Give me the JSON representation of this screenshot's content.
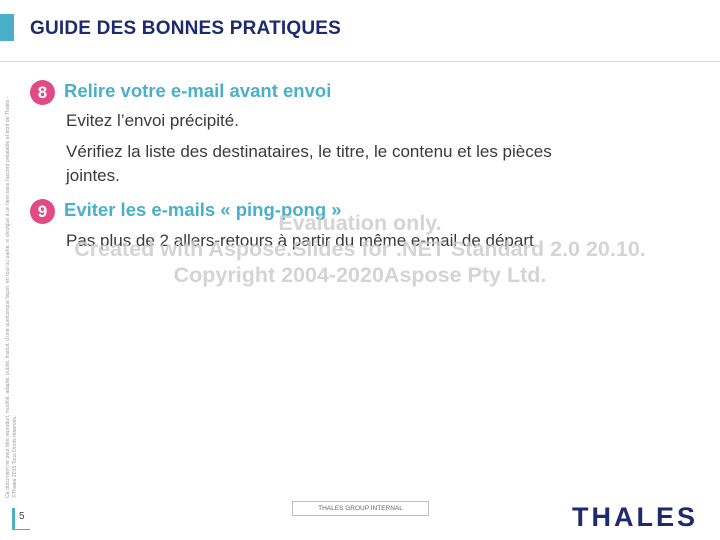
{
  "header": {
    "title": "GUIDE DES BONNES PRATIQUES"
  },
  "side_note": "Ce document ne peut être reproduit, modifié, adapté, publié, traduit, d'une quelconque façon, en tout ou partie, ni divulgué à un tiers sans l'accord préalable et écrit de Thales - ©Thales 2015 Tous Droits réservés.",
  "sections": [
    {
      "number": "8",
      "heading": "Relire votre e-mail avant envoi",
      "lines": [
        "Evitez l’envoi précipité.",
        "Vérifiez la liste des destinataires, le titre, le contenu et les pièces",
        "jointes."
      ]
    },
    {
      "number": "9",
      "heading": "Eviter les e-mails « ping-pong »",
      "lines": [
        "Pas plus de 2 allers-retours à partir du même e-mail de départ"
      ]
    }
  ],
  "watermark": {
    "line1": "Evaluation only.",
    "line2": "Created with Aspose.Slides for .NET Standard 2.0 20.10.",
    "line3": "Copyright 2004-2020Aspose Pty Ltd."
  },
  "footer": {
    "page_number": "5",
    "classification": "THALES GROUP INTERNAL",
    "logo": "THALES"
  },
  "colors": {
    "title": "#1e2a6e",
    "accent": "#4ab0c9",
    "badge": "#e04a85"
  }
}
